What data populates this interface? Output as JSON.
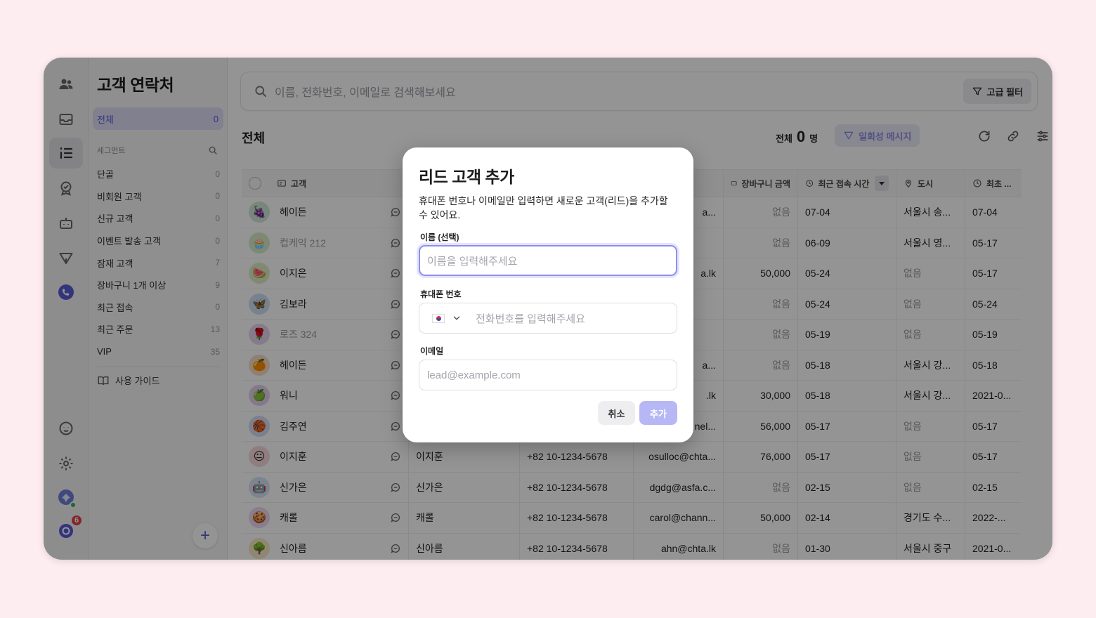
{
  "sidebar": {
    "title": "고객 연락처",
    "all_label": "전체",
    "all_count": "0",
    "segments_label": "세그먼트",
    "items": [
      {
        "label": "단골",
        "count": "0"
      },
      {
        "label": "비회원 고객",
        "count": "0"
      },
      {
        "label": "신규 고객",
        "count": "0"
      },
      {
        "label": "이벤트 발송 고객",
        "count": "0"
      },
      {
        "label": "잠재 고객",
        "count": "7"
      },
      {
        "label": "장바구니 1개 이상",
        "count": "9"
      },
      {
        "label": "최근 접속",
        "count": "0"
      },
      {
        "label": "최근 주문",
        "count": "13"
      },
      {
        "label": "VIP",
        "count": "35"
      }
    ],
    "guide_label": "사용 가이드",
    "add_label": "+"
  },
  "rail": {
    "notification_count": "6"
  },
  "search": {
    "placeholder": "이름, 전화번호, 이메일로 검색해보세요",
    "advanced_filter": "고급 필터"
  },
  "main": {
    "title": "전체",
    "summary_label": "전체",
    "summary_count": "0",
    "summary_unit": "명",
    "bulk_message": "일회성 메시지"
  },
  "table": {
    "headers": [
      "고객",
      "",
      "",
      "",
      "장바구니 금액",
      "최근 접속 시간",
      "도시",
      "최초 ..."
    ],
    "rows": [
      {
        "emoji": "🍇",
        "bg": "#cfe8d8",
        "name": "헤이든",
        "muted": false,
        "c1": "",
        "phone": "",
        "email": "a...",
        "cart": "없음",
        "cart_muted": true,
        "last": "07-04",
        "city": "서울시 송...",
        "city_muted": false,
        "first": "07-04"
      },
      {
        "emoji": "🧁",
        "bg": "#d6ecc8",
        "name": "컵케익 212",
        "muted": true,
        "c1": "",
        "phone": "",
        "email": "",
        "cart": "없음",
        "cart_muted": true,
        "last": "06-09",
        "city": "서울시 영...",
        "city_muted": false,
        "first": "05-17"
      },
      {
        "emoji": "🍉",
        "bg": "#e0edc4",
        "name": "이지은",
        "muted": false,
        "c1": "",
        "phone": "",
        "email": "a.lk",
        "cart": "50,000",
        "cart_muted": false,
        "last": "05-24",
        "city": "없음",
        "city_muted": true,
        "first": "05-17"
      },
      {
        "emoji": "🦋",
        "bg": "#cfe0f5",
        "name": "김보라",
        "muted": false,
        "c1": "",
        "phone": "",
        "email": "",
        "cart": "없음",
        "cart_muted": true,
        "last": "05-24",
        "city": "없음",
        "city_muted": true,
        "first": "05-24"
      },
      {
        "emoji": "🌹",
        "bg": "#e4d4f0",
        "name": "로즈 324",
        "muted": true,
        "c1": "",
        "phone": "",
        "email": "",
        "cart": "없음",
        "cart_muted": true,
        "last": "05-19",
        "city": "없음",
        "city_muted": true,
        "first": "05-19"
      },
      {
        "emoji": "🍊",
        "bg": "#f8dcc4",
        "name": "헤이든",
        "muted": false,
        "c1": "",
        "phone": "",
        "email": "a...",
        "cart": "없음",
        "cart_muted": true,
        "last": "05-18",
        "city": "서울시 강...",
        "city_muted": false,
        "first": "05-18"
      },
      {
        "emoji": "🍏",
        "bg": "#e4d0f0",
        "name": "워니",
        "muted": false,
        "c1": "",
        "phone": "",
        "email": ".lk",
        "cart": "30,000",
        "cart_muted": false,
        "last": "05-18",
        "city": "서울시 강...",
        "city_muted": false,
        "first": "2021-0..."
      },
      {
        "emoji": "🏀",
        "bg": "#d4dcf4",
        "name": "김주연",
        "muted": false,
        "c1": "",
        "phone": "",
        "email": "nel...",
        "cart": "56,000",
        "cart_muted": false,
        "last": "05-17",
        "city": "없음",
        "city_muted": true,
        "first": "05-17"
      },
      {
        "emoji": "😐",
        "bg": "#f8d8dc",
        "name": "이지훈",
        "muted": false,
        "c1": "이지훈",
        "phone": "+82 10-1234-5678",
        "email": "osulloc@chta...",
        "cart": "76,000",
        "cart_muted": false,
        "last": "05-17",
        "city": "없음",
        "city_muted": true,
        "first": "05-17"
      },
      {
        "emoji": "🤖",
        "bg": "#d6e4f8",
        "name": "신가은",
        "muted": false,
        "c1": "신가은",
        "phone": "+82 10-1234-5678",
        "email": "dgdg@asfa.c...",
        "cart": "없음",
        "cart_muted": true,
        "last": "02-15",
        "city": "없음",
        "city_muted": true,
        "first": "02-15"
      },
      {
        "emoji": "🍪",
        "bg": "#ecd8f4",
        "name": "캐롤",
        "muted": false,
        "c1": "캐롤",
        "phone": "+82 10-1234-5678",
        "email": "carol@chann...",
        "cart": "50,000",
        "cart_muted": false,
        "last": "02-14",
        "city": "경기도 수...",
        "city_muted": false,
        "first": "2022-..."
      },
      {
        "emoji": "🌳",
        "bg": "#f8e8c4",
        "name": "신아름",
        "muted": false,
        "c1": "신아름",
        "phone": "+82 10-1234-5678",
        "email": "ahn@chta.lk",
        "cart": "없음",
        "cart_muted": true,
        "last": "01-30",
        "city": "서울시 중구",
        "city_muted": false,
        "first": "2021-0..."
      }
    ]
  },
  "modal": {
    "title": "리드 고객 추가",
    "description": "휴대폰 번호나 이메일만 입력하면 새로운 고객(리드)을 추가할 수 있어요.",
    "name_label": "이름 (선택)",
    "name_placeholder": "이름을 입력해주세요",
    "phone_label": "휴대폰 번호",
    "phone_placeholder": "전화번호를 입력해주세요",
    "email_label": "이메일",
    "email_placeholder": "lead@example.com",
    "cancel_label": "취소",
    "add_label": "추가"
  },
  "colors": {
    "accent": "#5b5bd8",
    "background": "#fdecf0",
    "modal_add_disabled": "#b7b7f5"
  }
}
